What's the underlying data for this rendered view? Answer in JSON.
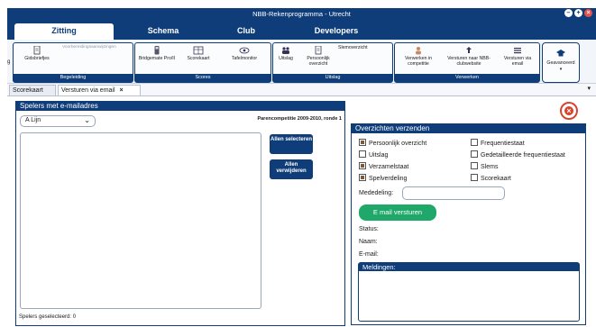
{
  "window": {
    "title": "NBB-Rekenprogramma - Utrecht",
    "btn_min": "–",
    "btn_max": "+",
    "btn_close": "×",
    "side_close": "×"
  },
  "menu": {
    "tabs": [
      {
        "label": "Zitting",
        "active": true
      },
      {
        "label": "Schema",
        "active": false
      },
      {
        "label": "Club",
        "active": false
      },
      {
        "label": "Developers",
        "active": false
      }
    ]
  },
  "ribbon": {
    "groups": [
      {
        "label": "Begeleiding",
        "buttons": [
          "Gidsbriefjes",
          "Voorbereidingsaanwijzingen"
        ]
      },
      {
        "label": "Scores",
        "buttons": [
          "Bridgemate Pro/II",
          "Scorekaart",
          "Tafelmonitor"
        ]
      },
      {
        "label": "Uitslag",
        "buttons": [
          "Uitslag",
          "Persoonlijk overzicht",
          "Slemoverzicht"
        ]
      },
      {
        "label": "Verwerken",
        "buttons": [
          "Verwerken in competitie",
          "Versturen naar NBB-clubwebsite",
          "Versturen via email"
        ]
      }
    ],
    "geavanceerd": "Geavanceerd"
  },
  "doc_tabs": [
    {
      "label": "Scorekaart",
      "active": false
    },
    {
      "label": "Versturen via email",
      "active": true,
      "close": "×"
    }
  ],
  "left_panel": {
    "title": "Spelers met e-mailadres",
    "select_value": "A  Lijn",
    "competition_label": "Parencompetitie 2009-2010, ronde 1",
    "btn_select_all": "Allen selecteren",
    "btn_remove_all": "Allen verwijderen",
    "footer": "Spelers geselecteerd: 0"
  },
  "right_panel": {
    "title": "Overzichten verzenden",
    "checkboxes": [
      {
        "label": "Persoonlijk overzicht",
        "checked": true
      },
      {
        "label": "Frequentiestaat",
        "checked": false
      },
      {
        "label": "Uitslag",
        "checked": false
      },
      {
        "label": "Gedetailleerde frequentiestaat",
        "checked": false
      },
      {
        "label": "Verzamelstaat",
        "checked": true
      },
      {
        "label": "Slems",
        "checked": false
      },
      {
        "label": "Spelverdeling",
        "checked": true
      },
      {
        "label": "Scorekaart",
        "checked": false
      }
    ],
    "mededeling_label": "Mededeling:",
    "mededeling_value": "",
    "send_button": "E mail versturen",
    "status_label": "Status:",
    "naam_label": "Naam:",
    "email_label": "E-mail:",
    "meldingen_title": "Meldingen:"
  },
  "colors": {
    "navy": "#0f3d7a",
    "send_green": "#1fa86a",
    "close_red": "#d9432e"
  },
  "icons": [
    "window-minimize-icon",
    "window-maximize-icon",
    "window-close-icon",
    "red-close-circle-icon",
    "dropdown-chevron-icon",
    "collapse-ribbon-icon"
  ]
}
